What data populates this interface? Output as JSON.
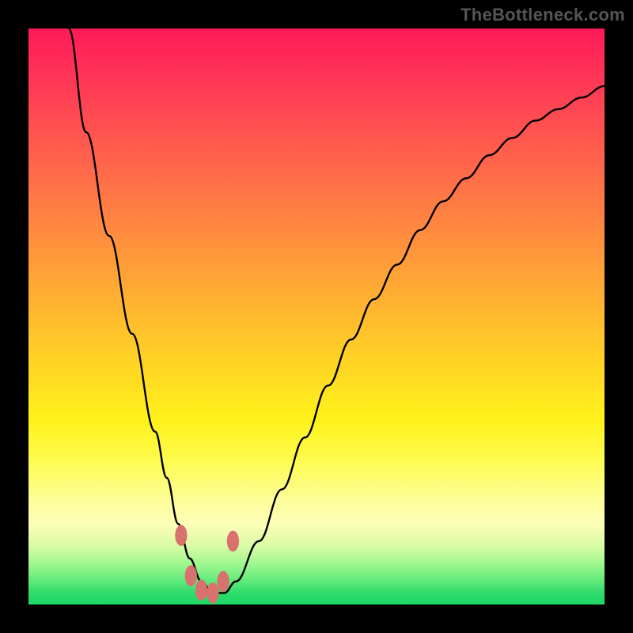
{
  "watermark": "TheBottleneck.com",
  "colors": {
    "gradient_top": "#ff1a58",
    "gradient_mid": "#fff21a",
    "gradient_bottom": "#1dd765",
    "curve": "#000000",
    "markers": "#d9716f",
    "frame": "#000000"
  },
  "chart_data": {
    "type": "line",
    "title": "",
    "xlabel": "",
    "ylabel": "",
    "xlim": [
      0,
      100
    ],
    "ylim": [
      0,
      100
    ],
    "grid": false,
    "legend": false,
    "series": [
      {
        "name": "bottleneck-curve",
        "x": [
          7,
          10,
          14,
          18,
          22,
          24,
          26,
          28,
          30,
          32,
          34,
          36,
          40,
          44,
          48,
          52,
          56,
          60,
          64,
          68,
          72,
          76,
          80,
          84,
          88,
          92,
          96,
          100
        ],
        "values": [
          100,
          82,
          64,
          47,
          30,
          22,
          14,
          8,
          4,
          2,
          2,
          4,
          11,
          20,
          29,
          38,
          46,
          53,
          59,
          65,
          70,
          74,
          78,
          81,
          84,
          86,
          88,
          90
        ]
      }
    ],
    "markers": [
      {
        "x": 26.5,
        "y": 12,
        "r": 1.4
      },
      {
        "x": 28.2,
        "y": 5,
        "r": 1.4
      },
      {
        "x": 30.0,
        "y": 2.5,
        "r": 1.4
      },
      {
        "x": 32.0,
        "y": 2,
        "r": 1.4
      },
      {
        "x": 33.8,
        "y": 4,
        "r": 1.4
      },
      {
        "x": 35.5,
        "y": 11,
        "r": 1.4
      }
    ]
  }
}
